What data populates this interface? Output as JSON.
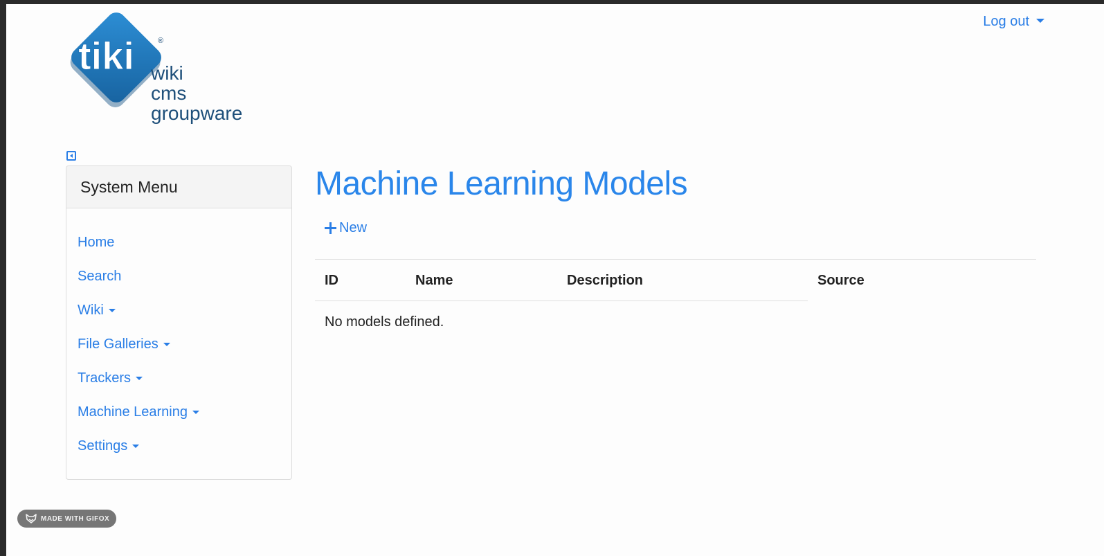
{
  "header": {
    "logo": {
      "mark_text": "tiki",
      "registered": "®",
      "tagline": [
        "wiki",
        "cms",
        "groupware"
      ]
    },
    "logout_label": "Log out"
  },
  "sidebar": {
    "title": "System Menu",
    "items": [
      {
        "label": "Home",
        "has_dropdown": false
      },
      {
        "label": "Search",
        "has_dropdown": false
      },
      {
        "label": "Wiki",
        "has_dropdown": true
      },
      {
        "label": "File Galleries",
        "has_dropdown": true
      },
      {
        "label": "Trackers",
        "has_dropdown": true
      },
      {
        "label": "Machine Learning",
        "has_dropdown": true
      },
      {
        "label": "Settings",
        "has_dropdown": true
      }
    ]
  },
  "main": {
    "title": "Machine Learning Models",
    "new_label": "New",
    "table": {
      "columns": [
        "ID",
        "Name",
        "Description",
        "Source"
      ],
      "empty_message": "No models defined."
    }
  },
  "badge": {
    "label": "MADE WITH GIFOX"
  },
  "colors": {
    "link": "#2a7ee6",
    "title": "#2a86ea",
    "logo_blue": "#1f73b7",
    "logo_text": "#1e4f7a"
  }
}
